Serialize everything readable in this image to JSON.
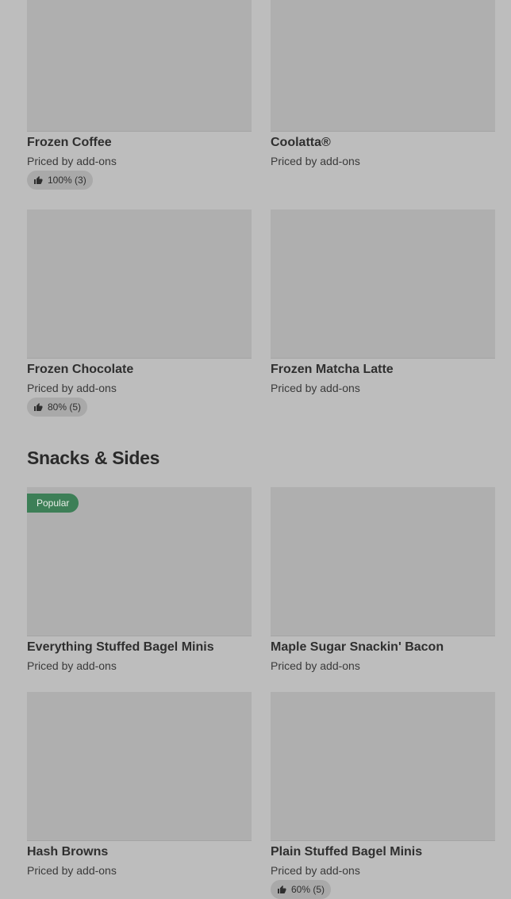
{
  "frozen": {
    "items": [
      {
        "name": "Frozen Coffee",
        "price": "Priced by add-ons",
        "rating": "100% (3)"
      },
      {
        "name": "Coolatta®",
        "price": "Priced by add-ons"
      },
      {
        "name": "Frozen Chocolate",
        "price": "Priced by add-ons",
        "rating": "80% (5)"
      },
      {
        "name": "Frozen Matcha Latte",
        "price": "Priced by add-ons"
      }
    ]
  },
  "snacks": {
    "title": "Snacks & Sides",
    "items": [
      {
        "name": "Everything Stuffed Bagel Minis",
        "price": "Priced by add-ons",
        "badge": "Popular"
      },
      {
        "name": "Maple Sugar Snackin' Bacon",
        "price": "Priced by add-ons"
      },
      {
        "name": "Hash Browns",
        "price": "Priced by add-ons"
      },
      {
        "name": "Plain Stuffed Bagel Minis",
        "price": "Priced by add-ons",
        "rating": "60% (5)"
      }
    ]
  },
  "colors": {
    "background": "#bdbdbd",
    "image_placeholder": "#afafaf",
    "badge": "#3d7f57"
  }
}
